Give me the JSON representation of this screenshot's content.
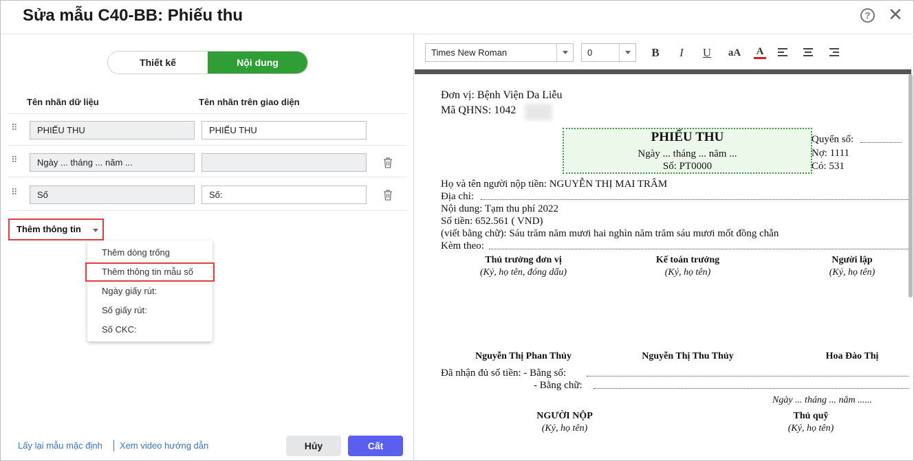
{
  "dialog": {
    "title": "Sửa mẫu C40-BB: Phiếu thu"
  },
  "tabs": {
    "design": "Thiết kế",
    "content": "Nội dung"
  },
  "columns": {
    "data_label": "Tên nhãn dữ liệu",
    "ui_label": "Tên nhãn trên giao diện"
  },
  "rows": [
    {
      "data": "PHIẾU THU",
      "ui": "PHIẾU THU"
    },
    {
      "data": "Ngày ... tháng ... năm ...",
      "ui": ""
    },
    {
      "data": "Số",
      "ui": "Số:"
    }
  ],
  "add_info": {
    "label": "Thêm thông tin",
    "menu": [
      "Thêm dòng trống",
      "Thêm thông tin mẫu số",
      "Ngày giấy rút:",
      "Số giấy rút:",
      "Số CKC:"
    ]
  },
  "footer": {
    "reset_link": "Lấy lại mẫu mặc định",
    "video_link": "Xem video hướng dẫn",
    "cancel": "Hủy",
    "save": "Cất"
  },
  "toolbar": {
    "font": "Times New Roman",
    "size": "0",
    "bold": "B",
    "italic": "I",
    "underline": "U",
    "font_size": "aA",
    "font_color": "A",
    "font_color_hex": "#d21f1f"
  },
  "doc": {
    "unit": "Đơn vị: Bệnh Viện Da Liễu",
    "qhns": "Mã QHNS: 1042",
    "title": "PHIẾU THU",
    "date": "Ngày ... tháng ... năm ...",
    "so": "Số:  PT0000",
    "quyen_so": "Quyển số: ",
    "no": "Nợ: 1111",
    "co": "Có: 531",
    "payer": "Họ và tên người nộp tiền: NGUYỄN THỊ MAI TRÂM",
    "address": "Địa chỉ: ",
    "content": "Nội dung: Tạm thu phí 2022",
    "amount": "Số tiền: 652.561   ( VND)",
    "amount_words": "(viết bằng chữ): Sáu trăm năm mươi hai nghìn năm trăm sáu mươi mốt đồng chẵn",
    "attached": "Kèm theo: ",
    "sign1_title": "Thủ trưởng đơn vị",
    "sign1_note": "(Ký, họ tên, đóng dấu)",
    "sign2_title": "Kế toán trưởng",
    "sign2_note": "(Ký, họ tên)",
    "sign3_title": "Người lập",
    "sign3_note": "(Ký, họ tên)",
    "sign1_name": "Nguyễn Thị Phan Thủy",
    "sign2_name": "Nguyễn Thị Thu Thủy",
    "sign3_name": "Hoa Đào Thị",
    "received": "Đã nhận đủ số tiền: - Bằng số: ",
    "received_words": "- Bằng chữ: ",
    "date2": "Ngày ... tháng ... năm ......",
    "payer_title": "NGƯỜI NỘP",
    "payer_note": "(Ký, họ tên)",
    "cashier_title": "Thủ quỹ",
    "cashier_note": "(Ký, họ tên)"
  }
}
